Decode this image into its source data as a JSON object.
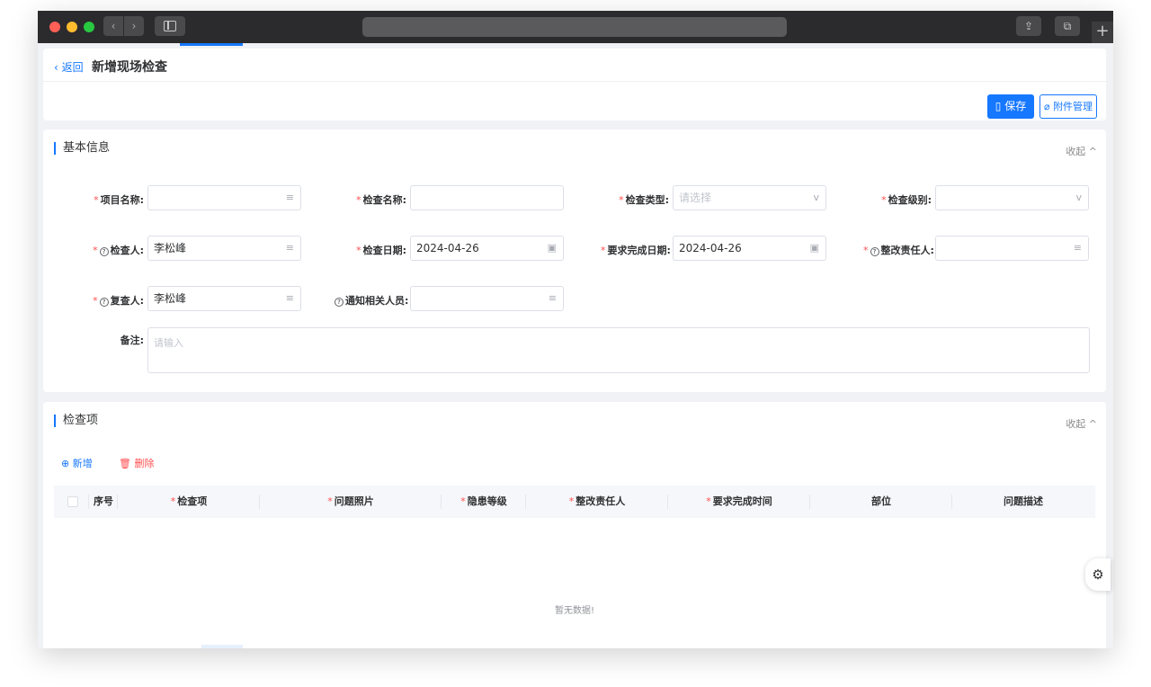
{
  "chrome": {
    "back_icon": "chevron-left-icon",
    "forward_icon": "chevron-right-icon",
    "share_icon": "share-icon",
    "tabs_icon": "tabs-icon",
    "plus_label": "+"
  },
  "header": {
    "back_label": "返回",
    "title": "新增现场检查",
    "save_label": "保存",
    "attach_label": "附件管理"
  },
  "basic": {
    "title": "基本信息",
    "collapse_label": "收起",
    "fields": {
      "project": {
        "label": "项目名称:",
        "value": ""
      },
      "check_name": {
        "label": "检查名称:",
        "value": ""
      },
      "check_type": {
        "label": "检查类型:",
        "placeholder": "请选择"
      },
      "check_level": {
        "label": "检查级别:",
        "value": ""
      },
      "inspector": {
        "label": "检查人:",
        "value": "李松峰"
      },
      "check_date": {
        "label": "检查日期:",
        "value": "2024-04-26"
      },
      "due_date": {
        "label": "要求完成日期:",
        "value": "2024-04-26"
      },
      "rectifier": {
        "label": "整改责任人:",
        "value": ""
      },
      "reviewer": {
        "label": "复查人:",
        "value": "李松峰"
      },
      "notify": {
        "label": "通知相关人员:",
        "value": ""
      },
      "remark": {
        "label": "备注:",
        "placeholder": "请输入"
      }
    }
  },
  "items": {
    "title": "检查项",
    "collapse_label": "收起",
    "add_label": "新增",
    "delete_label": "删除",
    "columns": [
      "序号",
      "检查项",
      "问题照片",
      "隐患等级",
      "整改责任人",
      "要求完成时间",
      "部位",
      "问题描述"
    ],
    "empty_text": "暂无数据!"
  },
  "colors": {
    "primary": "#1677ff",
    "required": "#ff4d4f",
    "background": "#f0f2f5"
  }
}
